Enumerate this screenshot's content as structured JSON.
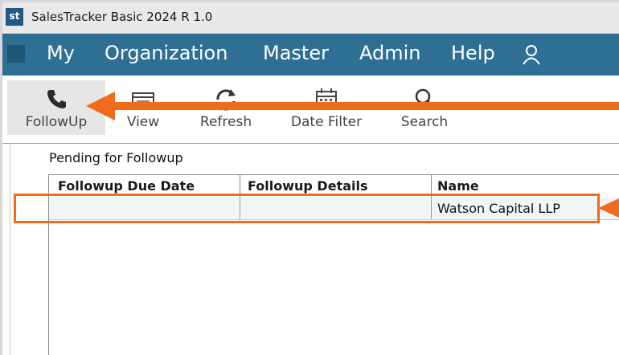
{
  "window": {
    "logo_text": "st",
    "title": "SalesTracker Basic 2024 R 1.0"
  },
  "menu": {
    "items": [
      "My",
      "Organization",
      "Master",
      "Admin",
      "Help"
    ],
    "user_icon": "user-icon"
  },
  "toolbar": {
    "buttons": [
      {
        "label": "FollowUp",
        "icon": "phone-icon",
        "active": true
      },
      {
        "label": "View",
        "icon": "view-window-icon",
        "active": false
      },
      {
        "label": "Refresh",
        "icon": "refresh-icon",
        "active": false
      },
      {
        "label": "Date Filter",
        "icon": "calendar-icon",
        "active": false
      },
      {
        "label": "Search",
        "icon": "search-icon",
        "active": false
      }
    ]
  },
  "section": {
    "title": "Pending for Followup"
  },
  "table": {
    "columns": [
      "Followup Due Date",
      "Followup Details",
      "Name"
    ],
    "rows": [
      [
        "",
        "",
        "Watson Capital LLP"
      ]
    ]
  },
  "colors": {
    "menu_bg": "#2f6f94",
    "callout": "#ef6c1a",
    "logo_bg": "#1f5a86"
  }
}
